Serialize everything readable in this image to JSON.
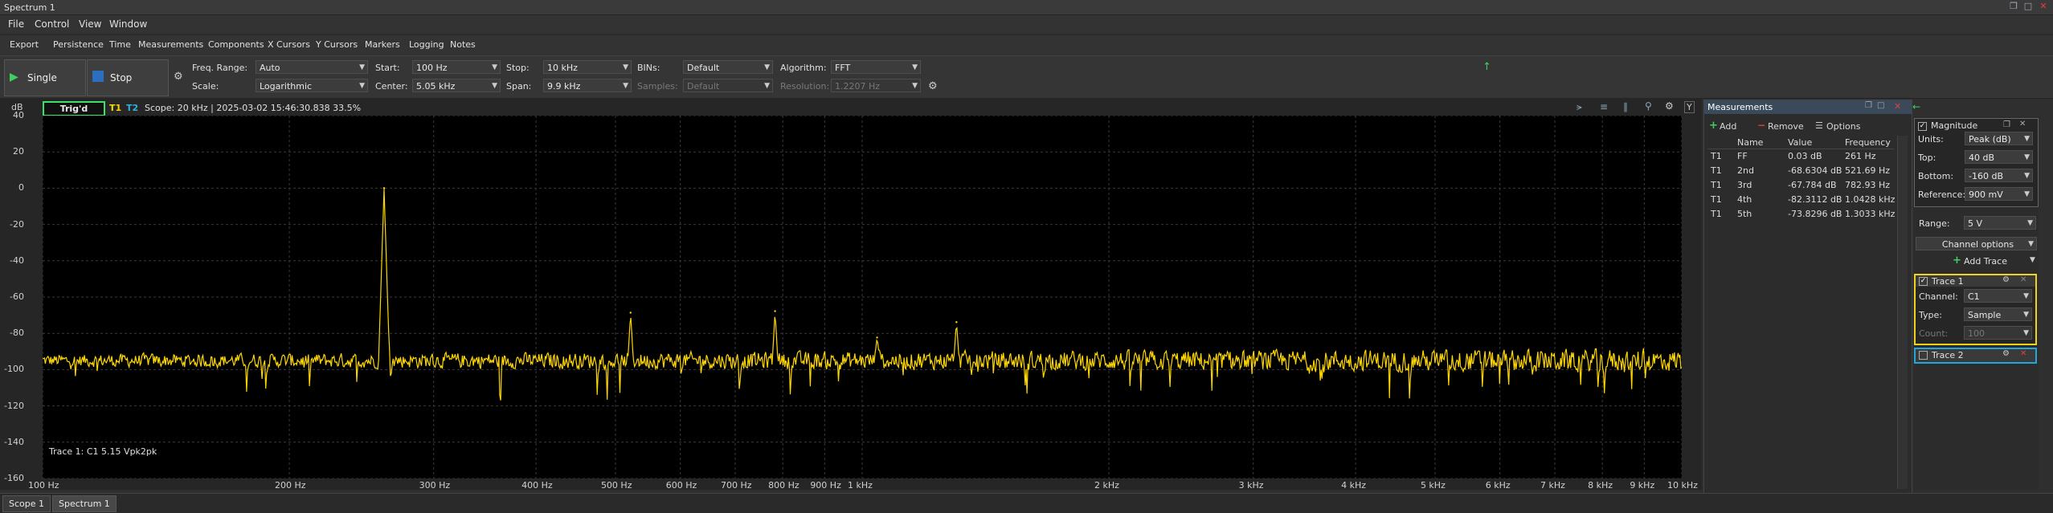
{
  "window": {
    "title": "Spectrum 1"
  },
  "menubar": {
    "items": [
      "File",
      "Control",
      "View",
      "Window"
    ]
  },
  "toolbar": {
    "items": [
      "Export",
      "Persistence",
      "Time",
      "Measurements",
      "Components",
      "X Cursors",
      "Y Cursors",
      "Markers",
      "Logging",
      "Notes"
    ]
  },
  "controls": {
    "single_label": "Single",
    "stop_label": "Stop",
    "freq_range_label": "Freq. Range:",
    "freq_range_value": "Auto",
    "scale_label": "Scale:",
    "scale_value": "Logarithmic",
    "start_label": "Start:",
    "start_value": "100 Hz",
    "center_label": "Center:",
    "center_value": "5.05 kHz",
    "stop_field_label": "Stop:",
    "stop_field_value": "10 kHz",
    "span_label": "Span:",
    "span_value": "9.9 kHz",
    "bins_label": "BINs:",
    "bins_value": "Default",
    "samples_label": "Samples:",
    "samples_value": "Default",
    "algorithm_label": "Algorithm:",
    "algorithm_value": "FFT",
    "resolution_label": "Resolution:",
    "resolution_value": "1.2207 Hz"
  },
  "plot": {
    "y_unit": "dB",
    "trigd_label": "Trig'd",
    "t1_label": "T1",
    "t2_label": "T2",
    "status_text": "Scope: 20 kHz | 2025-03-02 15:46:30.838 33.5%",
    "trace_info": "Trace 1: C1 5.15 Vpk2pk",
    "trace_color": "#ffd700"
  },
  "chart_data": {
    "type": "line",
    "title": "",
    "xlabel": "",
    "ylabel": "dB",
    "x_scale": "log",
    "xlim": [
      100,
      10000
    ],
    "ylim": [
      -160,
      40
    ],
    "grid": true,
    "y_ticks": [
      "40",
      "20",
      "0",
      "-20",
      "-40",
      "-60",
      "-80",
      "-100",
      "-120",
      "-140",
      "-160"
    ],
    "x_ticks": [
      "100 Hz",
      "200 Hz",
      "300 Hz",
      "400 Hz",
      "500 Hz",
      "600 Hz",
      "700 Hz",
      "800 Hz",
      "900 Hz",
      "1 kHz",
      "2 kHz",
      "3 kHz",
      "4 kHz",
      "5 kHz",
      "6 kHz",
      "7 kHz",
      "8 kHz",
      "9 kHz",
      "10 kHz"
    ],
    "x_tick_values": [
      100,
      200,
      300,
      400,
      500,
      600,
      700,
      800,
      900,
      1000,
      2000,
      3000,
      4000,
      5000,
      6000,
      7000,
      8000,
      9000,
      10000
    ],
    "series": [
      {
        "name": "Trace 1",
        "color": "#ffd700",
        "noise_floor_db": -95,
        "noise_spread_db": 14,
        "peaks": [
          {
            "x": 261,
            "y": 0.03
          },
          {
            "x": 521.69,
            "y": -68.63
          },
          {
            "x": 782.93,
            "y": -67.78
          },
          {
            "x": 1042.8,
            "y": -82.31
          },
          {
            "x": 1303.3,
            "y": -73.83
          }
        ]
      }
    ]
  },
  "measurements": {
    "title": "Measurements",
    "add_label": "Add",
    "remove_label": "Remove",
    "options_label": "Options",
    "columns": [
      "Name",
      "Value",
      "Frequency"
    ],
    "rows": [
      {
        "trace": "T1",
        "name": "FF",
        "value": "0.03 dB",
        "freq": "261 Hz"
      },
      {
        "trace": "T1",
        "name": "2nd",
        "value": "-68.6304 dB",
        "freq": "521.69 Hz"
      },
      {
        "trace": "T1",
        "name": "3rd",
        "value": "-67.784 dB",
        "freq": "782.93 Hz"
      },
      {
        "trace": "T1",
        "name": "4th",
        "value": "-82.3112 dB",
        "freq": "1.0428 kHz"
      },
      {
        "trace": "T1",
        "name": "5th",
        "value": "-73.8296 dB",
        "freq": "1.3033 kHz"
      }
    ]
  },
  "settings": {
    "magnitude_label": "Magnitude",
    "units_label": "Units:",
    "units_value": "Peak (dB)",
    "top_label": "Top:",
    "top_value": "40 dB",
    "bottom_label": "Bottom:",
    "bottom_value": "-160 dB",
    "reference_label": "Reference:",
    "reference_value": "900 mV",
    "range_label": "Range:",
    "range_value": "5 V",
    "channel_options_label": "Channel options",
    "add_trace_label": "Add Trace",
    "trace1_label": "Trace 1",
    "channel_label": "Channel:",
    "channel_value": "C1",
    "type_label": "Type:",
    "type_value": "Sample",
    "count_label": "Count:",
    "count_value": "100",
    "trace2_label": "Trace 2",
    "trace1_color": "#f0d020",
    "trace2_color": "#20a8d8"
  },
  "tabs": [
    "Scope 1",
    "Spectrum 1"
  ]
}
